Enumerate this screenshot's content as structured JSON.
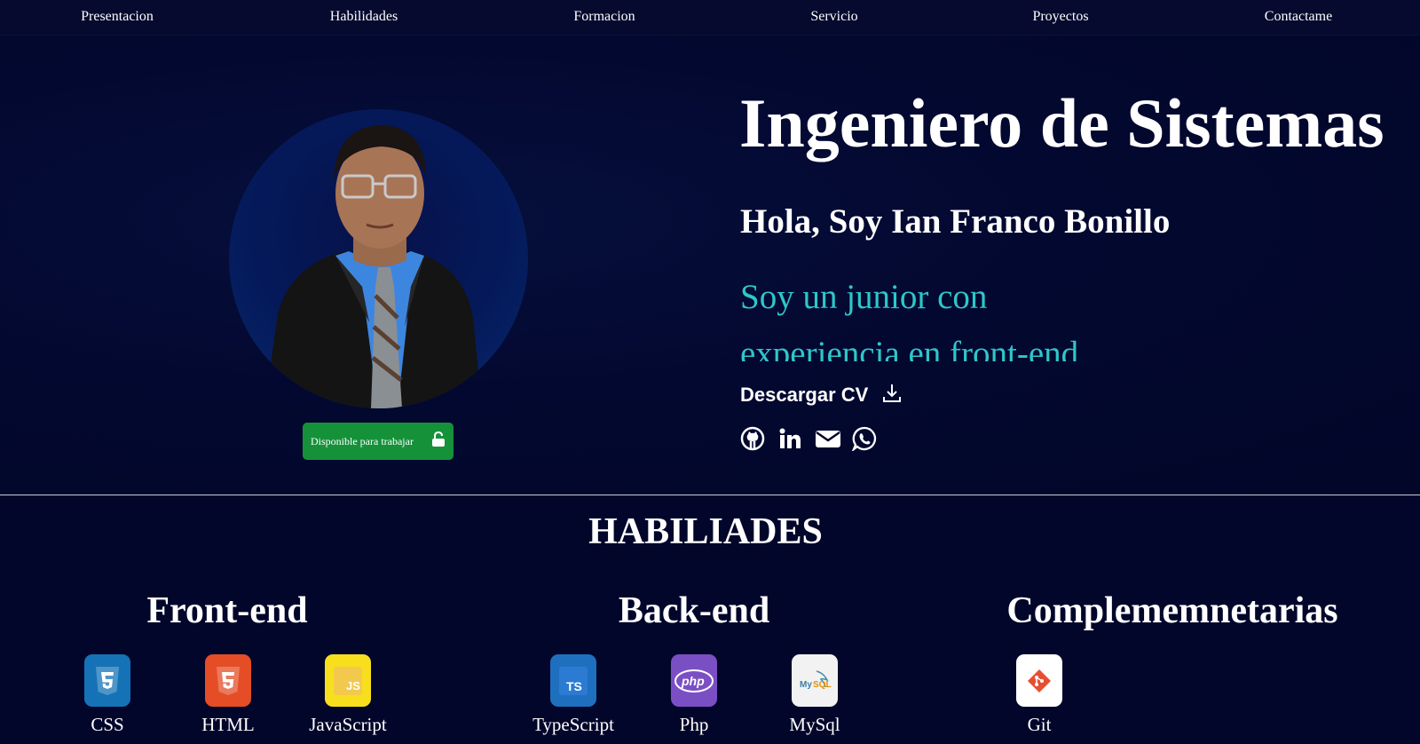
{
  "nav": {
    "items": [
      {
        "label": "Presentacion"
      },
      {
        "label": "Habilidades"
      },
      {
        "label": "Formacion"
      },
      {
        "label": "Servicio"
      },
      {
        "label": "Proyectos"
      },
      {
        "label": "Contactame"
      }
    ]
  },
  "hero": {
    "headline": "Ingeniero de Sistemas",
    "greeting": "Hola, Soy Ian Franco Bonillo",
    "tagline_line1": "Soy un junior con",
    "tagline_line2": "experiencia en front-end.",
    "cv_label": "Descargar CV",
    "cv_icon": "download-icon",
    "availability_badge": "Disponible para trabajar",
    "badge_icon": "unlock-icon",
    "badge_color": "#15913a",
    "accent_color": "#2ec7c9",
    "social_icons": [
      "github-icon",
      "linkedin-icon",
      "email-icon",
      "whatsapp-icon"
    ]
  },
  "skills": {
    "title": "HABILIADES",
    "columns": [
      {
        "title": "Front-end",
        "items": [
          {
            "name": "CSS",
            "icon": "css3-icon",
            "color": "#1572b6"
          },
          {
            "name": "HTML",
            "icon": "html5-icon",
            "color": "#e44d26"
          },
          {
            "name": "JavaScript",
            "icon": "javascript-icon",
            "color": "#f7df1e"
          }
        ]
      },
      {
        "title": "Back-end",
        "items": [
          {
            "name": "TypeScript",
            "icon": "typescript-icon",
            "color": "#1f6fbf"
          },
          {
            "name": "Php",
            "icon": "php-icon",
            "color": "#7b4fc4"
          },
          {
            "name": "MySql",
            "icon": "mysql-icon",
            "color": "#f2f2f2"
          }
        ]
      },
      {
        "title": "Complememnetarias",
        "items": [
          {
            "name": "Git",
            "icon": "git-icon",
            "color": "#ffffff"
          }
        ]
      }
    ]
  }
}
